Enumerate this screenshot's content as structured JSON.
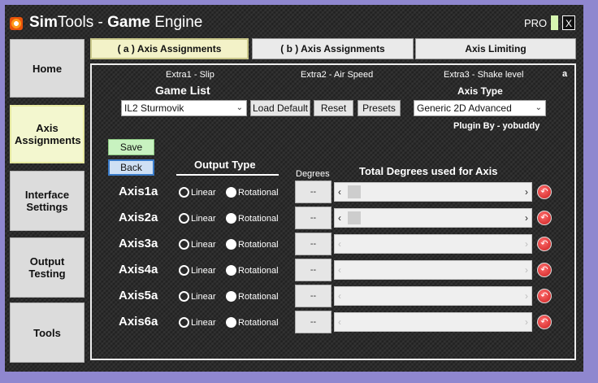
{
  "window": {
    "title_pre": "Sim",
    "title_a": "Tools - ",
    "title_bold": "Game",
    "title_b": " Engine",
    "pro": "PRO",
    "close": "X"
  },
  "sidebar": {
    "items": [
      {
        "label": "Home"
      },
      {
        "label": "Axis Assignments"
      },
      {
        "label": "Interface Settings"
      },
      {
        "label": "Output Testing"
      },
      {
        "label": "Tools"
      }
    ]
  },
  "tabs": [
    {
      "label": "( a ) Axis Assignments"
    },
    {
      "label": "( b ) Axis Assignments"
    },
    {
      "label": "Axis Limiting"
    }
  ],
  "panel": {
    "corner": "a",
    "extras": [
      "Extra1 - Slip",
      "Extra2 - Air Speed",
      "Extra3 - Shake level"
    ],
    "game_list_label": "Game List",
    "game_selected": "IL2 Sturmovik",
    "load_default": "Load Default",
    "reset": "Reset",
    "presets": "Presets",
    "axis_type_label": "Axis Type",
    "axis_type_selected": "Generic 2D Advanced",
    "plugin_by": "Plugin By - yobuddy",
    "save": "Save",
    "back": "Back",
    "output_type_label": "Output Type",
    "degrees_label": "Degrees",
    "total_degrees_label": "Total Degrees used for Axis",
    "linear": "Linear",
    "rotational": "Rotational",
    "deg_placeholder": "--",
    "axes": [
      {
        "name": "Axis1a",
        "output": "rotational",
        "enabled": true
      },
      {
        "name": "Axis2a",
        "output": "rotational",
        "enabled": true
      },
      {
        "name": "Axis3a",
        "output": "rotational",
        "enabled": false
      },
      {
        "name": "Axis4a",
        "output": "rotational",
        "enabled": false
      },
      {
        "name": "Axis5a",
        "output": "rotational",
        "enabled": false
      },
      {
        "name": "Axis6a",
        "output": "rotational",
        "enabled": false
      }
    ]
  }
}
